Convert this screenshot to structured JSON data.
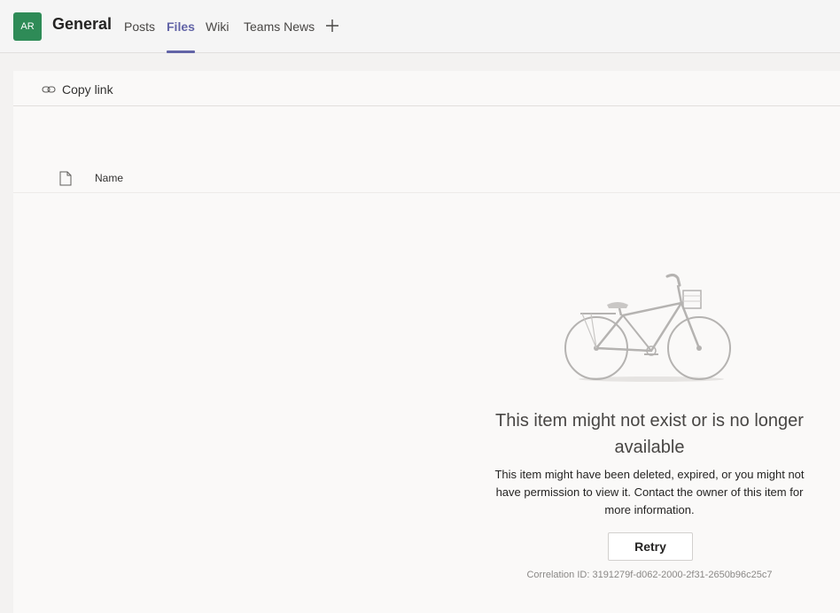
{
  "header": {
    "avatar_initials": "AR",
    "channel_title": "General",
    "tabs": [
      {
        "label": "Posts",
        "active": false
      },
      {
        "label": "Files",
        "active": true
      },
      {
        "label": "Wiki",
        "active": false
      },
      {
        "label": "Teams News",
        "active": false
      }
    ],
    "add_tab_icon": "plus-icon"
  },
  "command_bar": {
    "copy_link_label": "Copy link",
    "copy_link_icon": "link-icon"
  },
  "file_list": {
    "columns": [
      "Name"
    ],
    "file_type_icon": "document-icon"
  },
  "empty_state": {
    "illustration": "bicycle-illustration",
    "title": "This item might not exist or is no longer available",
    "message": "This item might have been deleted, expired, or you might not have permission to view it. Contact the owner of this item for more information.",
    "retry_label": "Retry",
    "correlation_id": "Correlation ID: 3191279f-d062-2000-2f31-2650b96c25c7"
  },
  "colors": {
    "accent": "#6264a7",
    "avatar": "#2e8b57",
    "panel_background": "#faf9f8"
  }
}
